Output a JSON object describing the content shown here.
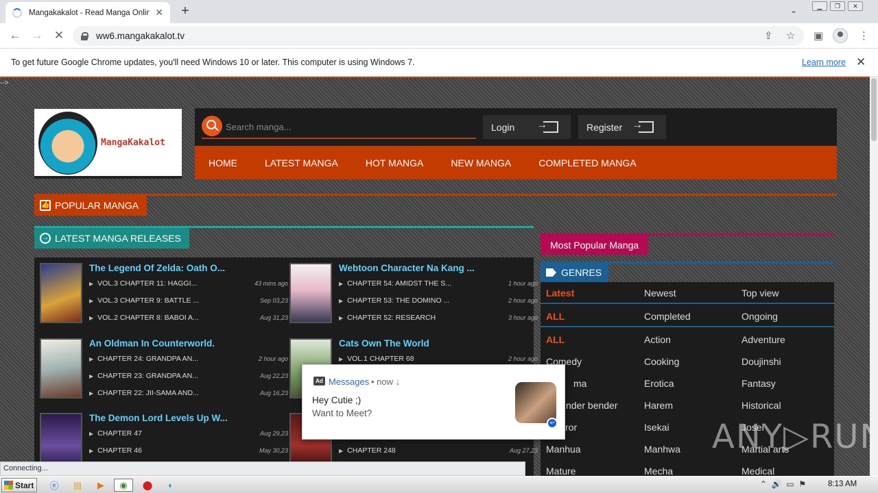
{
  "browser": {
    "tab_title": "Mangakakalot - Read Manga Online F",
    "url": "ww6.mangakakalot.tv",
    "info_message": "To get future Google Chrome updates, you'll need Windows 10 or later. This computer is using Windows 7.",
    "learn_more": "Learn more",
    "status_text": "Connecting..."
  },
  "site": {
    "comment_text": "-->",
    "brand": "MangaKakalot",
    "search_placeholder": "Search manga...",
    "login": "Login",
    "register": "Register",
    "nav": [
      "HOME",
      "LATEST MANGA",
      "HOT MANGA",
      "NEW MANGA",
      "COMPLETED MANGA"
    ],
    "popular_label": "POPULAR MANGA",
    "latest_label": "LATEST MANGA RELEASES",
    "most_popular_label": "Most Popular Manga",
    "genres_label": "GENRES"
  },
  "latest": [
    {
      "title": "The Legend Of Zelda: Oath O...",
      "chapters": [
        {
          "name": "VOL.3 CHAPTER 11: HAGGI...",
          "time": "43 mins ago"
        },
        {
          "name": "VOL.3 CHAPTER 9: BATTLE ...",
          "time": "Sep 03,23"
        },
        {
          "name": "VOL.2 CHAPTER 8: BABOI A...",
          "time": "Aug 31,23"
        }
      ]
    },
    {
      "title": "Webtoon Character Na Kang ...",
      "chapters": [
        {
          "name": "CHAPTER 54: AMIDST THE S...",
          "time": "1 hour ago"
        },
        {
          "name": "CHAPTER 53: THE DOMINO ...",
          "time": "2 hour ago"
        },
        {
          "name": "CHAPTER 52: RESEARCH",
          "time": "3 hour ago"
        }
      ]
    },
    {
      "title": "An Oldman In Counterworld.",
      "chapters": [
        {
          "name": "CHAPTER 24: GRANDPA AN...",
          "time": "2 hour ago"
        },
        {
          "name": "CHAPTER 23: GRANDPA AN...",
          "time": "Aug 22,23"
        },
        {
          "name": "CHAPTER 22: JII-SAMA AND...",
          "time": "Aug 16,23"
        }
      ]
    },
    {
      "title": "Cats Own The World",
      "chapters": [
        {
          "name": "VOL.1 CHAPTER 68",
          "time": "2 hour ago"
        }
      ]
    },
    {
      "title": "The Demon Lord Levels Up W...",
      "chapters": [
        {
          "name": "CHAPTER 47",
          "time": "Aug 29,23"
        },
        {
          "name": "CHAPTER 46",
          "time": "May 30,23"
        }
      ]
    },
    {
      "title": "",
      "chapters": [
        {
          "name": "CHAPTER 248",
          "time": "Aug 27,23"
        }
      ]
    }
  ],
  "genres": [
    [
      "Latest",
      "Newest",
      "Top view"
    ],
    [
      "ALL",
      "Completed",
      "Ongoing"
    ],
    [
      "ALL",
      "Action",
      "Adventure"
    ],
    [
      "Comedy",
      "Cooking",
      "Doujinshi"
    ],
    [
      "ma",
      "Erotica",
      "Fantasy"
    ],
    [
      "nder bender",
      "Harem",
      "Historical"
    ],
    [
      "ror",
      "Isekai",
      "Josei"
    ],
    [
      "Manhua",
      "Manhwa",
      "Martial arts"
    ],
    [
      "Mature",
      "Mecha",
      "Medical"
    ]
  ],
  "popup": {
    "ad": "Ad",
    "source": "Messages",
    "when": "• now ↓",
    "line1": "Hey Cutie ;)",
    "line2": "Want to Meet?"
  },
  "watermark": "ANY▷RUN",
  "taskbar": {
    "start": "Start",
    "clock": "8:13 AM"
  },
  "colors": {
    "accent": "#c33b00",
    "teal": "#1fa8a0",
    "link": "#61d1ff",
    "pink": "#b40a53",
    "blue": "#1c5f92"
  }
}
